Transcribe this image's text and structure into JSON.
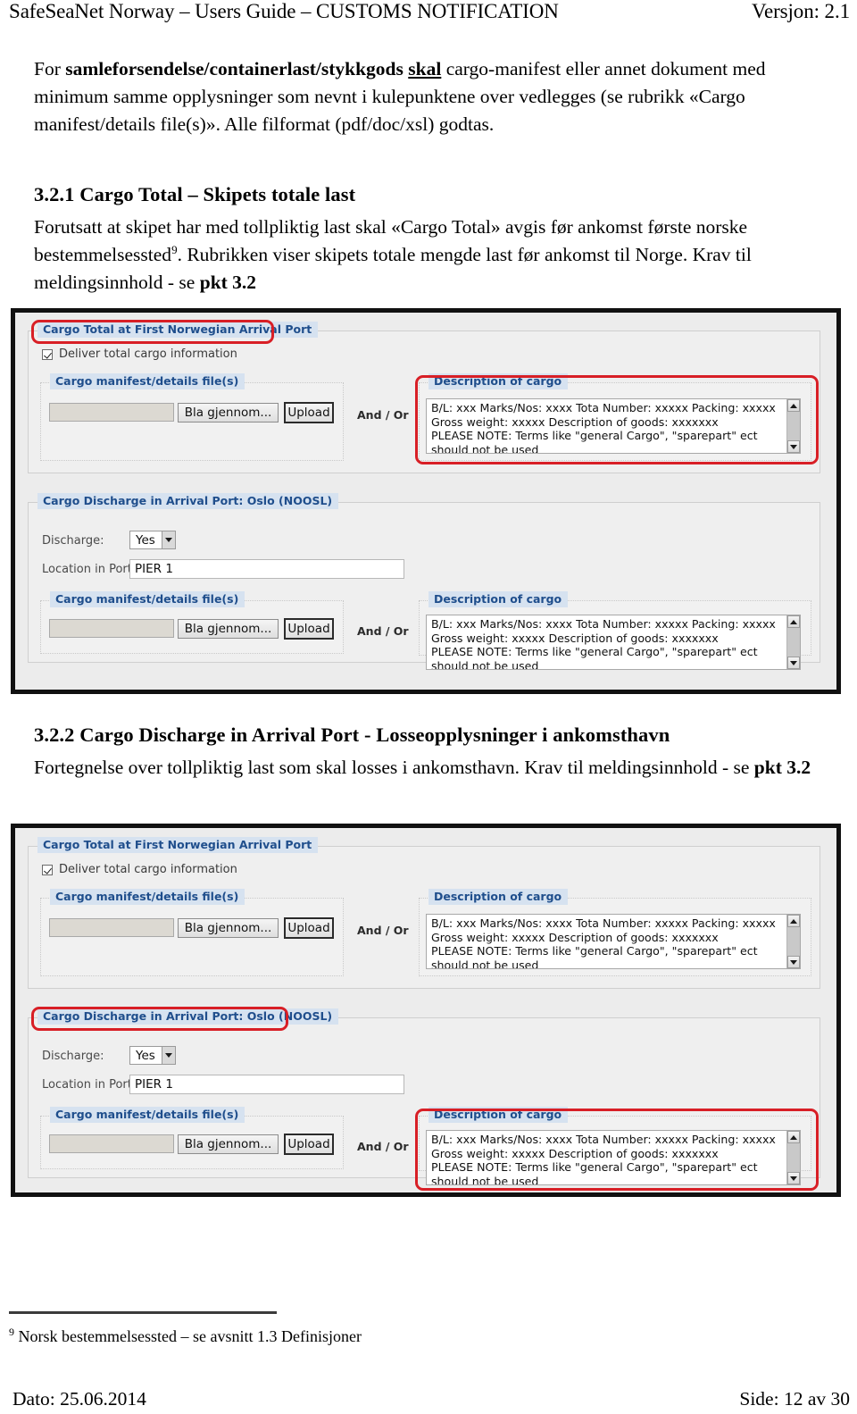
{
  "header": {
    "title": "SafeSeaNet Norway – Users Guide – CUSTOMS NOTIFICATION",
    "version": "Versjon: 2.1"
  },
  "intro": {
    "line_a_pre": "For ",
    "line_a_bold": "samleforsendelse/containerlast/stykkgods",
    "line_a_underline": "skal",
    "line_a_post": " cargo-manifest eller annet dokument",
    "line_b": "med minimum samme opplysninger som nevnt i kulepunktene over vedlegges (se rubrikk",
    "line_c": "«Cargo manifest/details file(s)». Alle filformat (pdf/doc/xsl) godtas."
  },
  "section_321": {
    "heading": "3.2.1 Cargo Total – Skipets totale last",
    "body_1_pre": "Forutsatt at skipet har med tollpliktig last skal «Cargo Total» avgis før ankomst første norske",
    "body_1_word": "bestemmelsessted",
    "body_1_footnote_marker": "9",
    "body_1_post": ". Rubrikken viser skipets totale mengde last før ankomst til Norge.",
    "body_2_pre": "Krav til meldingsinnhold - se ",
    "body_2_bold": "pkt 3.2"
  },
  "section_322": {
    "heading": "3.2.2 Cargo Discharge in Arrival Port - Losseopplysninger i ankomsthavn",
    "body_1": "Fortegnelse over tollpliktig last som skal losses i ankomsthavn.",
    "body_2_pre": "Krav til meldingsinnhold - se ",
    "body_2_bold": "pkt 3.2"
  },
  "app": {
    "cargo_total_legend": "Cargo Total at First Norwegian Arrival Port",
    "deliver_checkbox_label": "Deliver total cargo information",
    "manifest_legend": "Cargo manifest/details file(s)",
    "browse_button": "Bla gjennom...",
    "upload_button": "Upload",
    "and_or": "And / Or",
    "description_legend": "Description of cargo",
    "description_lines": [
      "B/L: xxx Marks/Nos: xxxx Tota Number: xxxxx Packing: xxxxx",
      "Gross weight: xxxxx Description of goods: xxxxxxx",
      "PLEASE NOTE: Terms like \"general Cargo\", \"sparepart\" ect",
      "should not be used"
    ],
    "discharge_legend": "Cargo Discharge in Arrival Port: Oslo (NOOSL)",
    "discharge_label": "Discharge:",
    "discharge_value": "Yes",
    "location_label": "Location in Port:",
    "location_value": "PIER 1",
    "file_path_value": ""
  },
  "footnote": {
    "marker": "9",
    "text": " Norsk bestemmelsessted – se avsnitt 1.3 Definisjoner"
  },
  "footer": {
    "date": "Dato: 25.06.2014",
    "page": "Side: 12 av 30"
  },
  "colors": {
    "highlight": "#d81f26",
    "legend_text": "#1f4e8c",
    "legend_bg": "#d6e2f0"
  }
}
